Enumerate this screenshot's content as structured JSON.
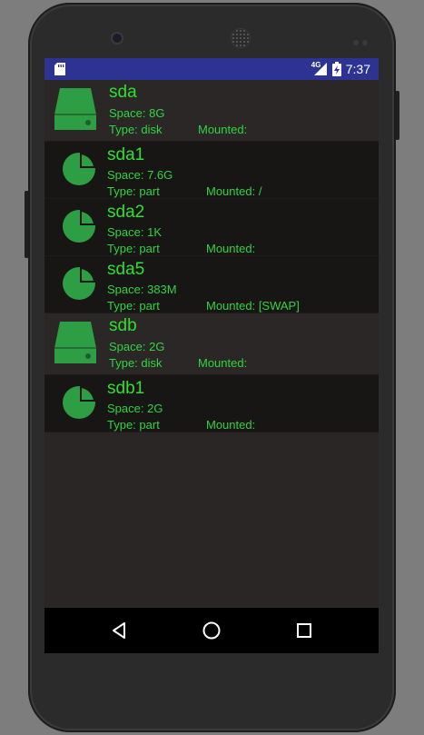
{
  "status": {
    "time": "7:37",
    "network": "4G",
    "icons": [
      "sd-card-icon",
      "signal-icon",
      "battery-charging-icon"
    ]
  },
  "colors": {
    "accent": "#2ee02e",
    "icon_green": "#2e9e44",
    "status_bar": "#2d3393"
  },
  "devices": [
    {
      "kind": "disk",
      "name": "sda",
      "space": "Space: 8G",
      "type": "Type: disk",
      "mounted": "Mounted:"
    },
    {
      "kind": "part",
      "name": "sda1",
      "space": "Space: 7.6G",
      "type": "Type: part",
      "mounted": "Mounted: /"
    },
    {
      "kind": "part",
      "name": "sda2",
      "space": "Space: 1K",
      "type": "Type: part",
      "mounted": "Mounted:"
    },
    {
      "kind": "part",
      "name": "sda5",
      "space": "Space: 383M",
      "type": "Type: part",
      "mounted": "Mounted: [SWAP]"
    },
    {
      "kind": "disk",
      "name": "sdb",
      "space": "Space: 2G",
      "type": "Type: disk",
      "mounted": "Mounted:"
    },
    {
      "kind": "part",
      "name": "sdb1",
      "space": "Space: 2G",
      "type": "Type: part",
      "mounted": "Mounted:"
    }
  ],
  "nav": [
    "back-button",
    "home-button",
    "recents-button"
  ]
}
